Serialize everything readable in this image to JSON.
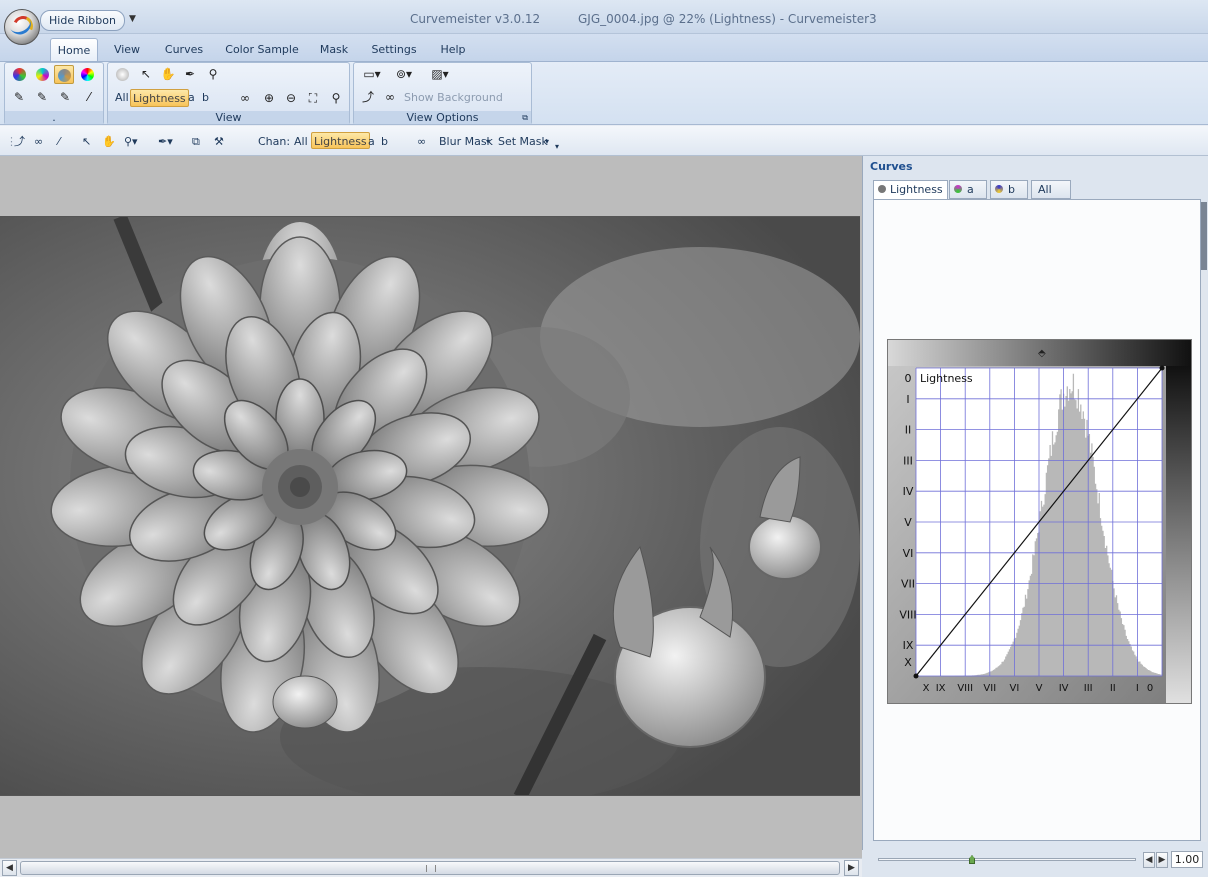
{
  "window": {
    "hide_ribbon": "Hide Ribbon",
    "app_title": "Curvemeister v3.0.12",
    "doc_title": "GJG_0004.jpg @ 22% (Lightness) - Curvemeister3"
  },
  "menu_tabs": [
    "Home",
    "View",
    "Curves",
    "Color Sample",
    "Mask",
    "Settings",
    "Help"
  ],
  "ribbon": {
    "group1_caption": ".",
    "view_caption": "View",
    "view_options_caption": "View Options",
    "channel_all": "All",
    "channel_lightness": "Lightness",
    "channel_a": "a",
    "channel_b": "b",
    "show_background_layers": "Show Background Layers"
  },
  "toolbar": {
    "chan_label": "Chan:",
    "all": "All",
    "lightness": "Lightness",
    "a": "a",
    "b": "b",
    "blur_mask": "Blur Mask",
    "set_mask": "Set Mask"
  },
  "panel": {
    "title": "Curves",
    "tabs": [
      "Lightness",
      "a",
      "b",
      "All"
    ],
    "zoom_value": "1.00",
    "zoom_slider_fraction": 0.36
  },
  "chart_data": {
    "type": "line",
    "title": "Lightness",
    "y_tick_labels": [
      "0",
      "I",
      "II",
      "III",
      "IV",
      "V",
      "VI",
      "VII",
      "VIII",
      "IX",
      "X"
    ],
    "x_tick_labels": [
      "X",
      "IX",
      "VIII",
      "VII",
      "VI",
      "V",
      "IV",
      "III",
      "II",
      "I",
      "0"
    ],
    "curve_points": [
      [
        0,
        0
      ],
      [
        100,
        100
      ]
    ],
    "xlim": [
      0,
      100
    ],
    "ylim": [
      0,
      100
    ],
    "grid": true,
    "histogram": true
  },
  "colors": {
    "accent_highlight": "#f8c45a",
    "grid_line": "#6f6fd8",
    "panel_title": "#1e4f8f"
  }
}
